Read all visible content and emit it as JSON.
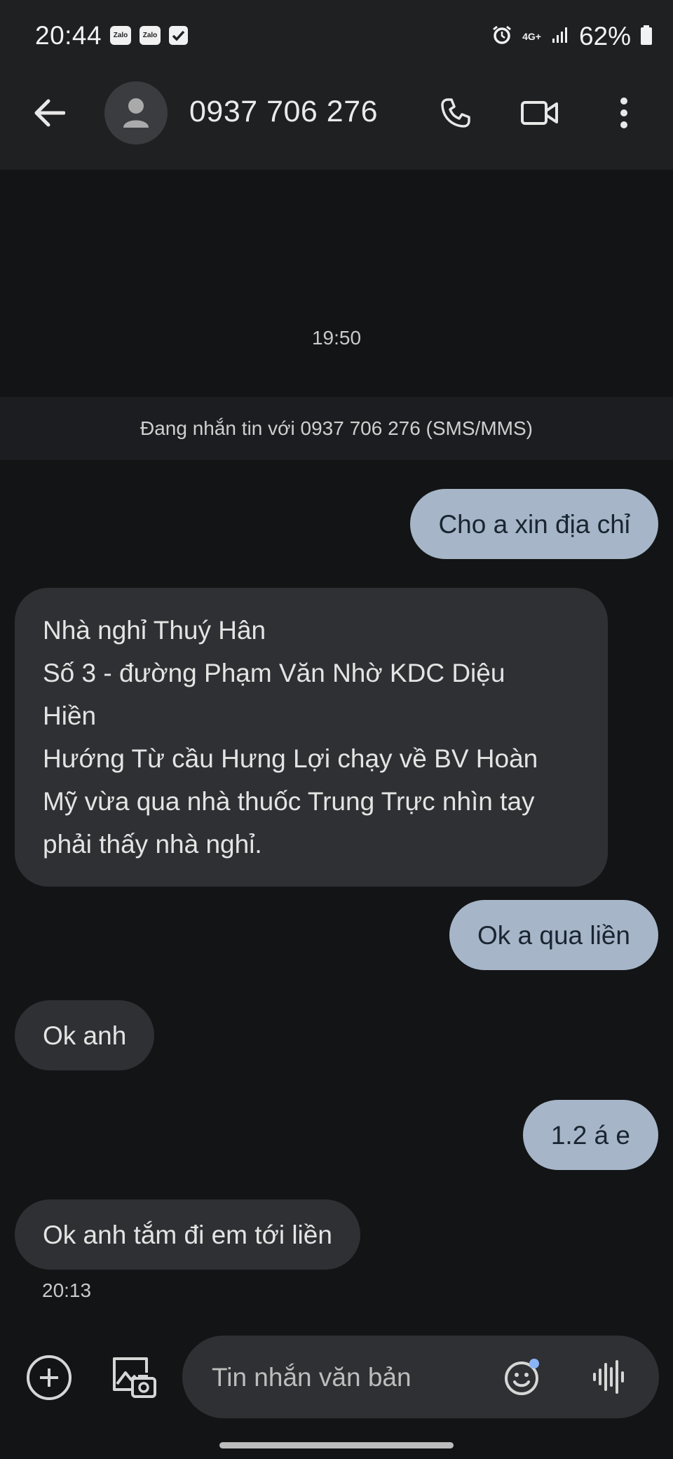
{
  "status_bar": {
    "time": "20:44",
    "notif_icons": [
      "zalo-icon",
      "zalo-icon",
      "checkbox-icon"
    ],
    "zalo_label": "Zalo",
    "network_label": "4G+",
    "battery": "62%"
  },
  "header": {
    "title": "0937 706 276",
    "icons": [
      "back-arrow-icon",
      "contact-avatar-icon",
      "phone-icon",
      "video-camera-icon",
      "more-vert-icon"
    ]
  },
  "conversation": {
    "timestamp_top": "19:50",
    "banner": "Đang nhắn tin với 0937 706 276 (SMS/MMS)",
    "messages": [
      {
        "direction": "sent",
        "lines": [
          "Cho a xin địa chỉ"
        ]
      },
      {
        "direction": "received",
        "lines": [
          "Nhà nghỉ Thuý Hân",
          "Số 3 - đường Phạm Văn Nhờ KDC Diệu",
          "Hiền",
          "Hướng Từ cầu Hưng Lợi chạy về BV Hoàn",
          "Mỹ vừa qua nhà thuốc Trung Trực nhìn tay",
          "phải thấy nhà nghỉ."
        ]
      },
      {
        "direction": "sent",
        "lines": [
          "Ok a qua liền"
        ]
      },
      {
        "direction": "received",
        "lines": [
          "Ok anh"
        ]
      },
      {
        "direction": "sent",
        "lines": [
          "1.2 á e"
        ]
      },
      {
        "direction": "received",
        "lines": [
          "Ok anh tắm đi em tới liền"
        ]
      }
    ],
    "timestamp_bottom": "20:13"
  },
  "compose": {
    "placeholder": "Tin nhắn văn bản",
    "icons": [
      "add-circle-icon",
      "gallery-camera-icon",
      "emoji-icon",
      "voice-waveform-icon"
    ]
  },
  "colors": {
    "background": "#131416",
    "app_bar": "#1f2022",
    "sent_bubble": "#a6b6c8",
    "received_bubble": "#2f3033",
    "accent_dot": "#8ab4f8"
  }
}
